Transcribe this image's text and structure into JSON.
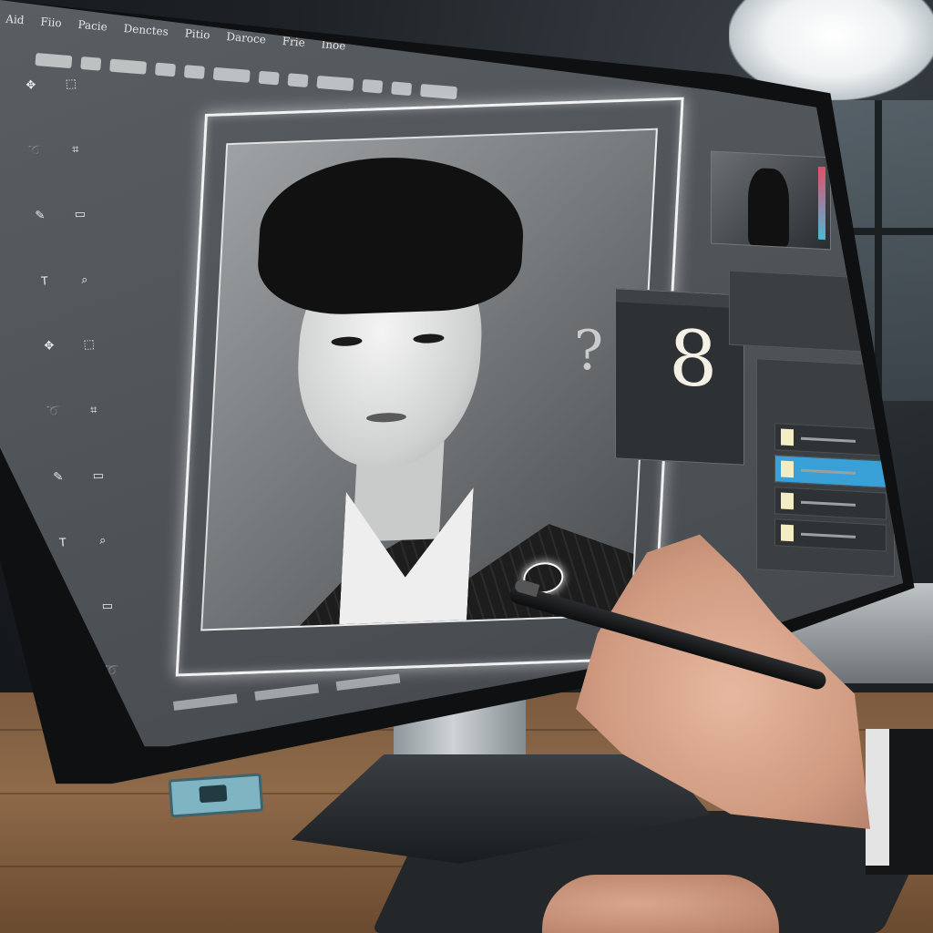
{
  "menu": {
    "items": [
      "Aid",
      "Fiio",
      "Pacie",
      "Denctes",
      "Pitio",
      "Daroce",
      "Frie",
      "Inoe"
    ]
  },
  "options_bar": {
    "tool_count": 12
  },
  "floating_panel": {
    "glyph": "8",
    "ghost_glyph": "?"
  },
  "colors": {
    "bezel": "#0e1012",
    "screen": "#4d5256",
    "selection_glow": "#ffffff",
    "active_layer": "#3aa0d8",
    "desk": "#8e6a49"
  },
  "icons": {
    "move": "✥",
    "marquee": "⬚",
    "lasso": "➰",
    "crop": "⌗",
    "brush": "✎",
    "eraser": "▭",
    "text": "T",
    "zoom": "⌕"
  }
}
